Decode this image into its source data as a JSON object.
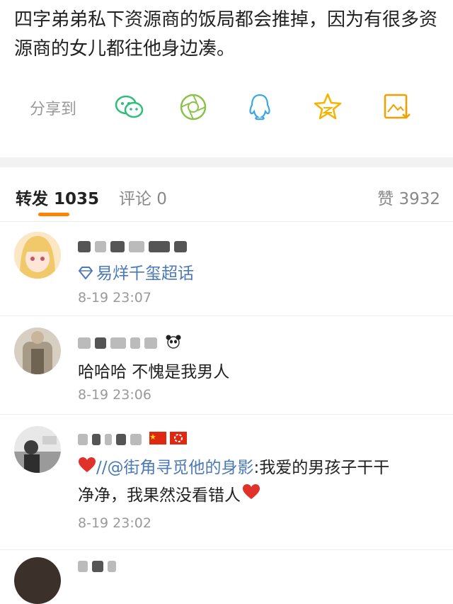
{
  "post": {
    "text": "四字弟弟私下资源商的饭局都会推掉，因为有很多资源商的女儿都往他身边凑。"
  },
  "share": {
    "label": "分享到",
    "icons": [
      "wechat-icon",
      "moments-icon",
      "qq-icon",
      "qzone-icon",
      "save-image-icon"
    ]
  },
  "tabs": {
    "repost": "转发 1035",
    "comment": "评论 0",
    "like": "赞 3932"
  },
  "colors": {
    "accent": "#ff8200",
    "link": "#4b79b8",
    "time": "#9a9a9a"
  },
  "reposts": [
    {
      "content": "易烊千玺超话",
      "time": "8-19 23:07"
    },
    {
      "content": "哈哈哈 不愧是我男人",
      "time": "8-19 23:06"
    },
    {
      "prefix": "//",
      "mention": "@街角寻觅他的身影",
      "content_line1": ":我爱的男孩子干干",
      "content_line2": "净净，我果然没看错人",
      "time": "8-19 23:02"
    }
  ]
}
